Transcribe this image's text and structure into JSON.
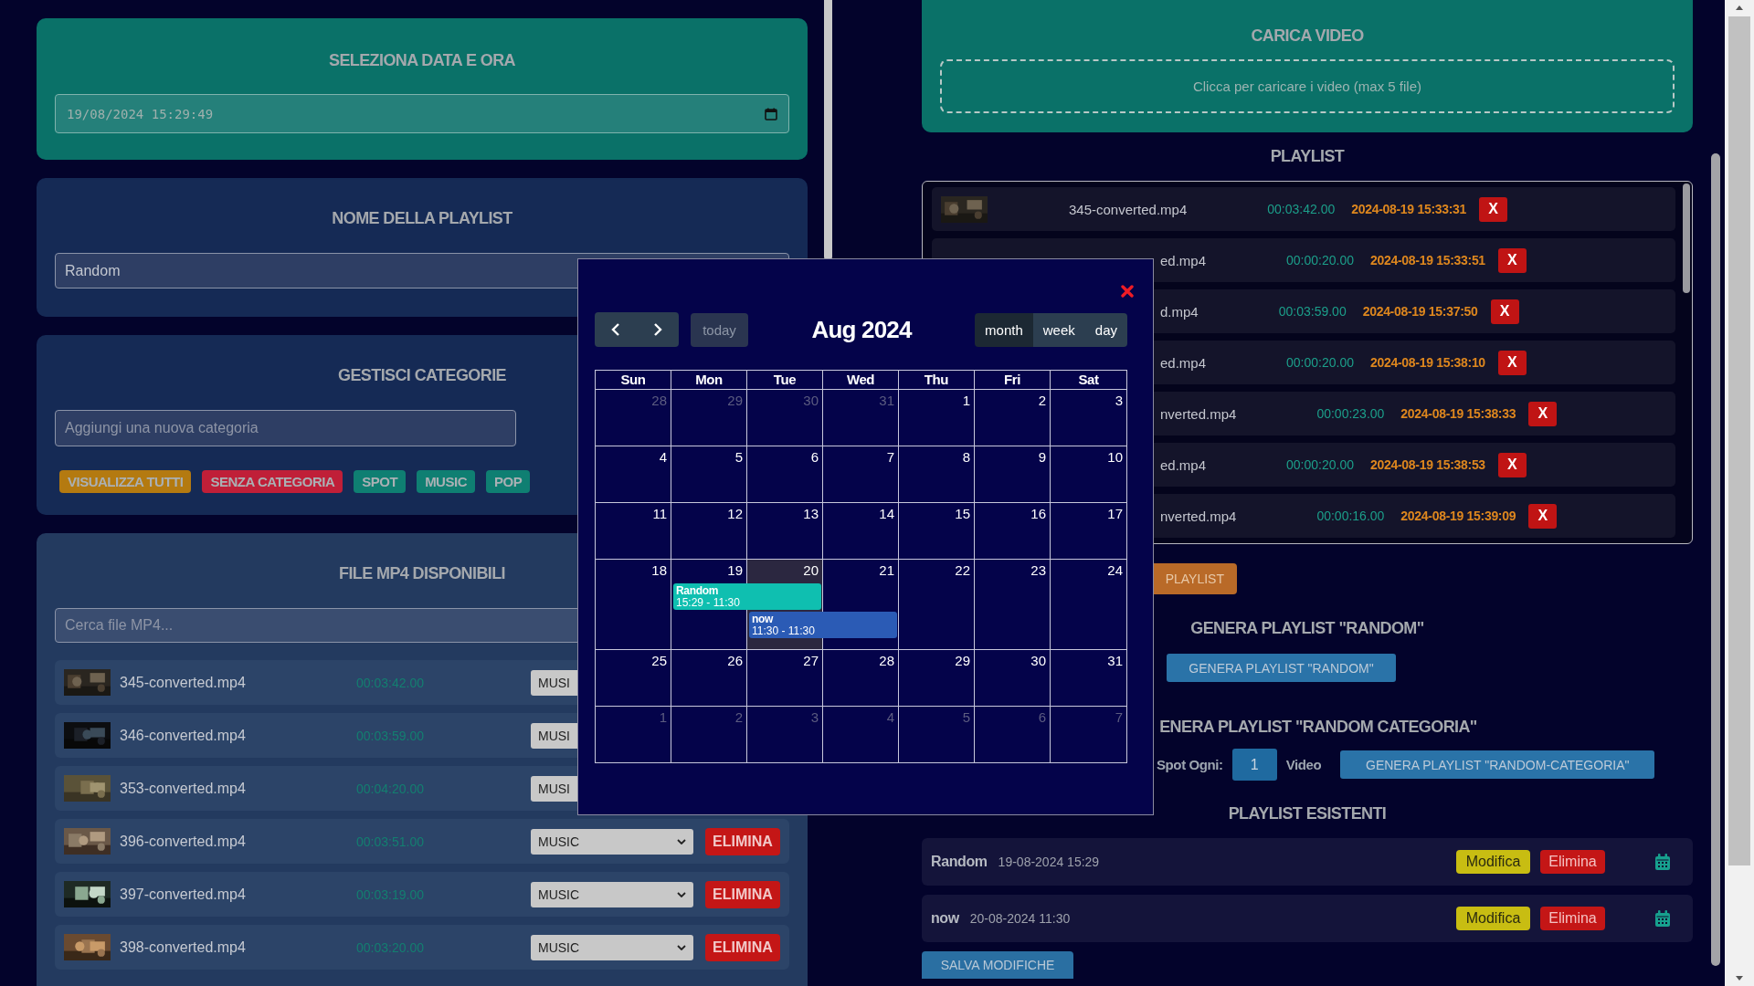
{
  "date_section": {
    "title": "SELEZIONA DATA E ORA",
    "value": "19/08/2024 15:29:49"
  },
  "name_section": {
    "title": "NOME DELLA PLAYLIST",
    "value": "Random"
  },
  "categories": {
    "title": "GESTISCI CATEGORIE",
    "placeholder": "Aggiungi una nuova categoria",
    "tags": [
      {
        "label": "VISUALIZZA TUTTI",
        "color": "#b47a10"
      },
      {
        "label": "SENZA CATEGORIA",
        "color": "#c01f38"
      },
      {
        "label": "SPOT",
        "color": "#0f7f72"
      },
      {
        "label": "MUSIC",
        "color": "#0f7f72"
      },
      {
        "label": "POP",
        "color": "#0f7f72"
      }
    ]
  },
  "files": {
    "title": "FILE MP4 DISPONIBILI",
    "placeholder": "Cerca file MP4...",
    "rows": [
      {
        "name": "345-converted.mp4",
        "duration": "00:03:42.00",
        "category": "MUSI"
      },
      {
        "name": "346-converted.mp4",
        "duration": "00:03:59.00",
        "category": "MUSI"
      },
      {
        "name": "353-converted.mp4",
        "duration": "00:04:20.00",
        "category": "MUSI"
      },
      {
        "name": "396-converted.mp4",
        "duration": "00:03:51.00",
        "category": "MUSIC",
        "action": "ELIMINA"
      },
      {
        "name": "397-converted.mp4",
        "duration": "00:03:19.00",
        "category": "MUSIC",
        "action": "ELIMINA"
      },
      {
        "name": "398-converted.mp4",
        "duration": "00:03:20.00",
        "category": "MUSIC",
        "action": "ELIMINA"
      }
    ]
  },
  "upload": {
    "title": "CARICA VIDEO",
    "hint": "Clicca per caricare i video (max 5 file)"
  },
  "playlist": {
    "title": "PLAYLIST",
    "rows": [
      {
        "thumbnail": true,
        "name": "345-converted.mp4",
        "duration": "00:03:42.00",
        "time": "2024-08-19 15:33:31",
        "remove": "X"
      },
      {
        "thumbnail": false,
        "name": "ed.mp4",
        "duration": "00:00:20.00",
        "time": "2024-08-19 15:33:51",
        "remove": "X"
      },
      {
        "thumbnail": false,
        "name": "d.mp4",
        "duration": "00:03:59.00",
        "time": "2024-08-19 15:37:50",
        "remove": "X"
      },
      {
        "thumbnail": false,
        "name": "ed.mp4",
        "duration": "00:00:20.00",
        "time": "2024-08-19 15:38:10",
        "remove": "X"
      },
      {
        "thumbnail": false,
        "name": "nverted.mp4",
        "duration": "00:00:23.00",
        "time": "2024-08-19 15:38:33",
        "remove": "X"
      },
      {
        "thumbnail": false,
        "name": "ed.mp4",
        "duration": "00:00:20.00",
        "time": "2024-08-19 15:38:53",
        "remove": "X"
      },
      {
        "thumbnail": false,
        "name": "nverted.mp4",
        "duration": "00:00:16.00",
        "time": "2024-08-19 15:39:09",
        "remove": "X"
      }
    ],
    "save": "PLAYLIST"
  },
  "random": {
    "title": "GENERA PLAYLIST \"RANDOM\"",
    "button": "GENERA PLAYLIST \"RANDOM\""
  },
  "random_category": {
    "title": "ENERA PLAYLIST \"RANDOM CATEGORIA\"",
    "spot_label": "Spot Ogni:",
    "spot_value": "1",
    "video_label": "Video",
    "button": "GENERA PLAYLIST \"RANDOM-CATEGORIA\""
  },
  "existing": {
    "title": "PLAYLIST ESISTENTI",
    "rows": [
      {
        "name": "Random",
        "date": "19-08-2024 15:29",
        "edit": "Modifica",
        "delete": "Elimina"
      },
      {
        "name": "now",
        "date": "20-08-2024 11:30",
        "edit": "Modifica",
        "delete": "Elimina"
      }
    ],
    "save": "SALVA MODIFICHE"
  },
  "calendar": {
    "today": "today",
    "title": "Aug 2024",
    "views": [
      {
        "label": "month",
        "selected": true
      },
      {
        "label": "week",
        "selected": false
      },
      {
        "label": "day",
        "selected": false
      }
    ],
    "weekdays": [
      "Sun",
      "Mon",
      "Tue",
      "Wed",
      "Thu",
      "Fri",
      "Sat"
    ],
    "weeks": [
      {
        "days": [
          {
            "n": "28",
            "outside": true,
            "today": false
          },
          {
            "n": "29",
            "outside": true,
            "today": false
          },
          {
            "n": "30",
            "outside": true,
            "today": false
          },
          {
            "n": "31",
            "outside": true,
            "today": false
          },
          {
            "n": "1",
            "outside": false,
            "today": false
          },
          {
            "n": "2",
            "outside": false,
            "today": false
          },
          {
            "n": "3",
            "outside": false,
            "today": false
          }
        ]
      },
      {
        "days": [
          {
            "n": "4",
            "outside": false,
            "today": false
          },
          {
            "n": "5",
            "outside": false,
            "today": false
          },
          {
            "n": "6",
            "outside": false,
            "today": false
          },
          {
            "n": "7",
            "outside": false,
            "today": false
          },
          {
            "n": "8",
            "outside": false,
            "today": false
          },
          {
            "n": "9",
            "outside": false,
            "today": false
          },
          {
            "n": "10",
            "outside": false,
            "today": false
          }
        ]
      },
      {
        "days": [
          {
            "n": "11",
            "outside": false,
            "today": false
          },
          {
            "n": "12",
            "outside": false,
            "today": false
          },
          {
            "n": "13",
            "outside": false,
            "today": false
          },
          {
            "n": "14",
            "outside": false,
            "today": false
          },
          {
            "n": "15",
            "outside": false,
            "today": false
          },
          {
            "n": "16",
            "outside": false,
            "today": false
          },
          {
            "n": "17",
            "outside": false,
            "today": false
          }
        ]
      },
      {
        "days": [
          {
            "n": "18",
            "outside": false,
            "today": false
          },
          {
            "n": "19",
            "outside": false,
            "today": false,
            "events": [
              {
                "title": "Random",
                "time": "15:29 - 11:30",
                "color": "#0fbfb0",
                "continues": true
              }
            ]
          },
          {
            "n": "20",
            "outside": false,
            "today": true,
            "events": [
              {
                "title": "now",
                "time": "11:30 - 11:30",
                "color": "#2b5bb5",
                "continues": true
              }
            ]
          },
          {
            "n": "21",
            "outside": false,
            "today": false
          },
          {
            "n": "22",
            "outside": false,
            "today": false
          },
          {
            "n": "23",
            "outside": false,
            "today": false
          },
          {
            "n": "24",
            "outside": false,
            "today": false
          }
        ]
      },
      {
        "days": [
          {
            "n": "25",
            "outside": false,
            "today": false
          },
          {
            "n": "26",
            "outside": false,
            "today": false
          },
          {
            "n": "27",
            "outside": false,
            "today": false
          },
          {
            "n": "28",
            "outside": false,
            "today": false
          },
          {
            "n": "29",
            "outside": false,
            "today": false
          },
          {
            "n": "30",
            "outside": false,
            "today": false
          },
          {
            "n": "31",
            "outside": false,
            "today": false
          }
        ]
      },
      {
        "days": [
          {
            "n": "1",
            "outside": true,
            "today": false
          },
          {
            "n": "2",
            "outside": true,
            "today": false
          },
          {
            "n": "3",
            "outside": true,
            "today": false
          },
          {
            "n": "4",
            "outside": true,
            "today": false
          },
          {
            "n": "5",
            "outside": true,
            "today": false
          },
          {
            "n": "6",
            "outside": true,
            "today": false
          },
          {
            "n": "7",
            "outside": true,
            "today": false
          }
        ]
      }
    ]
  }
}
